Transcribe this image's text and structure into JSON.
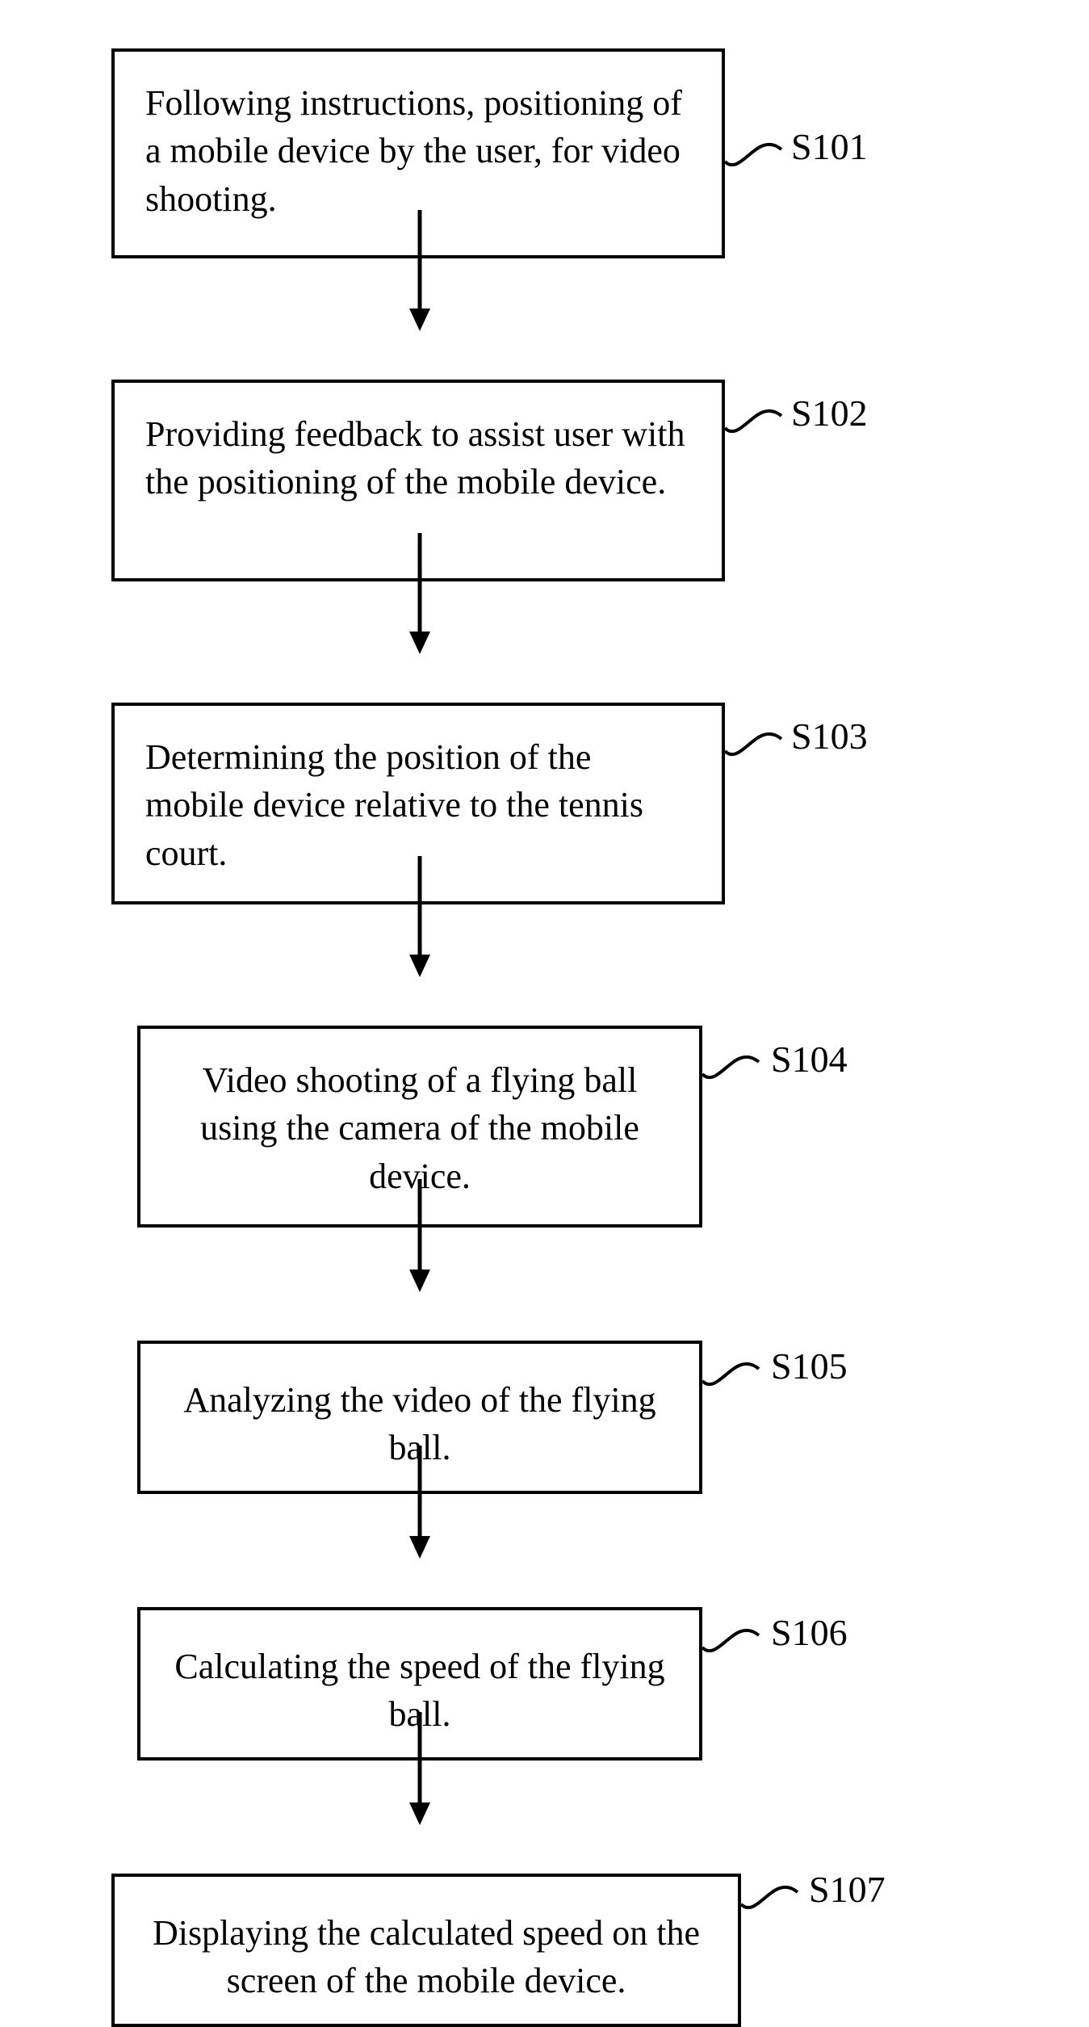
{
  "flowchart": {
    "steps": [
      {
        "id": "s101",
        "label": "S101",
        "text": "Following instructions, positioning of a mobile device by the user, for video shooting."
      },
      {
        "id": "s102",
        "label": "S102",
        "text": "Providing feedback to assist user with the positioning of the mobile device."
      },
      {
        "id": "s103",
        "label": "S103",
        "text": "Determining the position of the mobile device relative to the tennis court."
      },
      {
        "id": "s104",
        "label": "S104",
        "text": "Video shooting of a flying ball using the camera of the mobile device."
      },
      {
        "id": "s105",
        "label": "S105",
        "text": "Analyzing the video of the flying ball."
      },
      {
        "id": "s106",
        "label": "S106",
        "text": "Calculating the speed of the flying ball."
      },
      {
        "id": "s107",
        "label": "S107",
        "text": "Displaying the calculated speed on the screen of the mobile device."
      }
    ]
  }
}
